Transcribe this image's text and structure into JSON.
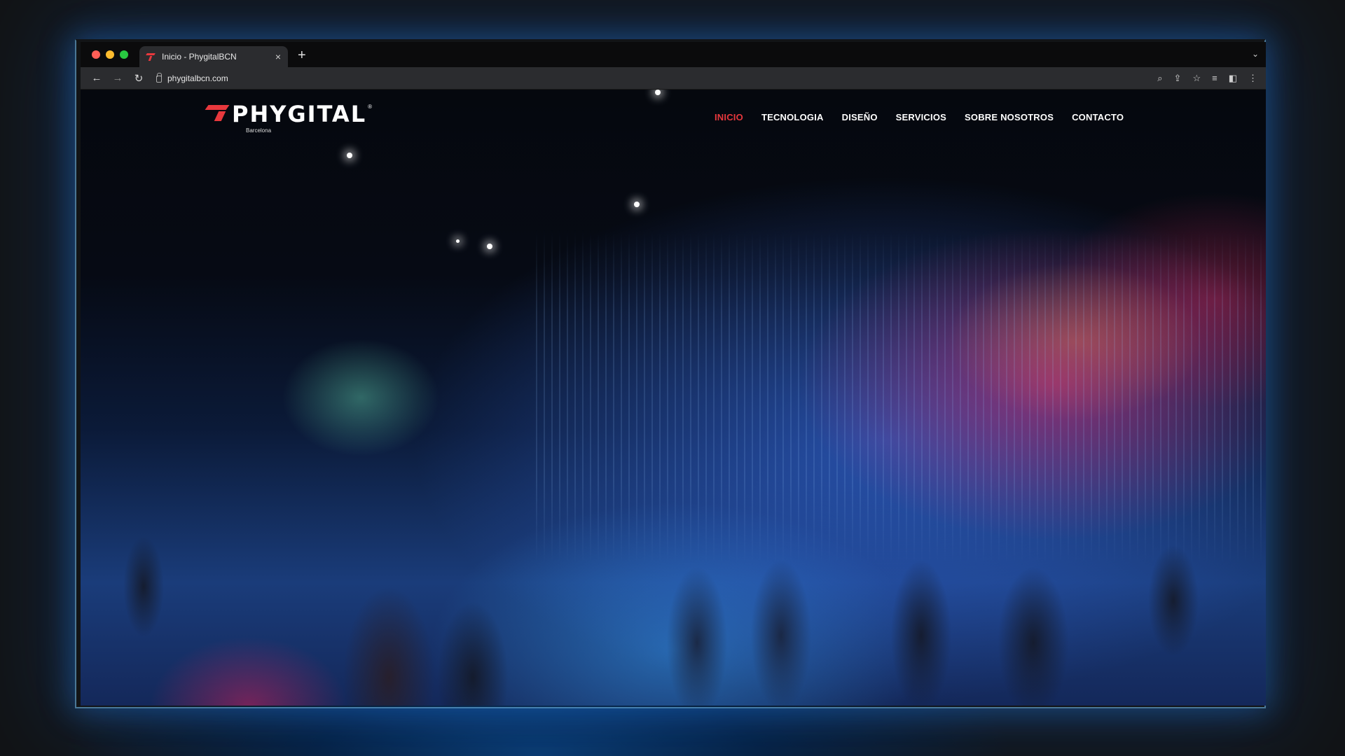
{
  "browser": {
    "tab_title": "Inicio - PhygitalBCN",
    "tab_close": "×",
    "new_tab": "+",
    "tab_menu": "⌄",
    "url": "phygitalbcn.com",
    "traffic_colors": [
      "#ff5f57",
      "#febc2e",
      "#28c840"
    ],
    "icons": [
      "back-icon",
      "forward-icon",
      "reload-icon",
      "lock-icon",
      "zoom-icon",
      "share-icon",
      "star-icon",
      "reading-list-icon",
      "sidebar-icon",
      "menu-icon"
    ]
  },
  "site": {
    "logo_text": "PHYGITAL",
    "logo_reg": "®",
    "logo_sub": "Barcelona",
    "accent": "#e8383d",
    "nav": [
      {
        "label": "INICIO",
        "active": true
      },
      {
        "label": "TECNOLOGIA",
        "active": false
      },
      {
        "label": "DISEÑO",
        "active": false
      },
      {
        "label": "SERVICIOS",
        "active": false
      },
      {
        "label": "SOBRE NOSOTROS",
        "active": false
      },
      {
        "label": "CONTACTO",
        "active": false
      }
    ]
  }
}
